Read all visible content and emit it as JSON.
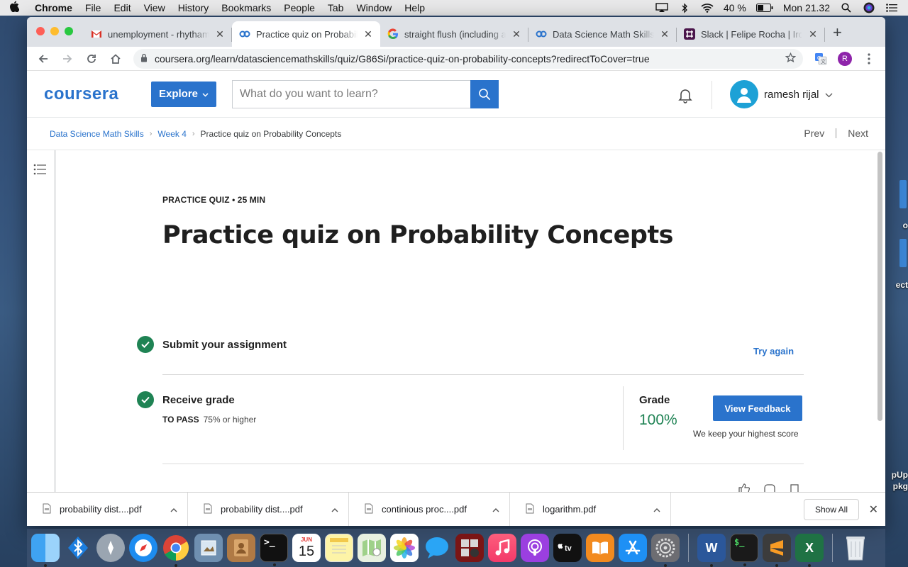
{
  "menubar": {
    "app": "Chrome",
    "items": [
      "File",
      "Edit",
      "View",
      "History",
      "Bookmarks",
      "People",
      "Tab",
      "Window",
      "Help"
    ],
    "battery": "40 %",
    "clock": "Mon 21.32"
  },
  "tabs": [
    {
      "title": "unemployment - rhythami",
      "icon": "gmail-icon",
      "active": false
    },
    {
      "title": "Practice quiz on Probabili",
      "icon": "coursera-icon",
      "active": true
    },
    {
      "title": "straight flush (including a",
      "icon": "google-icon",
      "active": false
    },
    {
      "title": "Data Science Math Skills",
      "icon": "coursera-icon",
      "active": false
    },
    {
      "title": "Slack | Felipe Rocha | Iron",
      "icon": "slack-icon",
      "active": false
    }
  ],
  "address": {
    "url": "coursera.org/learn/datasciencemathskills/quiz/G86Si/practice-quiz-on-probability-concepts?redirectToCover=true",
    "profile_initial": "R"
  },
  "header": {
    "logo": "coursera",
    "explore_label": "Explore",
    "search_placeholder": "What do you want to learn?",
    "username": "ramesh rijal"
  },
  "breadcrumb": {
    "items": [
      "Data Science Math Skills",
      "Week 4"
    ],
    "current": "Practice quiz on Probability Concepts",
    "prev": "Prev",
    "next": "Next"
  },
  "quiz": {
    "kicker": "PRACTICE QUIZ • 25 MIN",
    "title": "Practice quiz on Probability Concepts",
    "submit_label": "Submit your assignment",
    "try_again": "Try again",
    "receive_label": "Receive grade",
    "to_pass_label": "TO PASS",
    "to_pass_value": "75% or higher",
    "grade_label": "Grade",
    "grade_value": "100%",
    "view_feedback": "View Feedback",
    "keep_note": "We keep your highest score"
  },
  "downloads": {
    "files": [
      "probability dist....pdf",
      "probability dist....pdf",
      "continious proc....pdf",
      "logarithm.pdf"
    ],
    "show_all": "Show All"
  },
  "desktop": {
    "labels": [
      "o",
      "ect",
      "pUp",
      "pkg"
    ]
  },
  "dock": {
    "calendar_month": "JUN",
    "calendar_day": "15"
  },
  "colors": {
    "accent": "#2a73cc",
    "success": "#1f8354"
  }
}
